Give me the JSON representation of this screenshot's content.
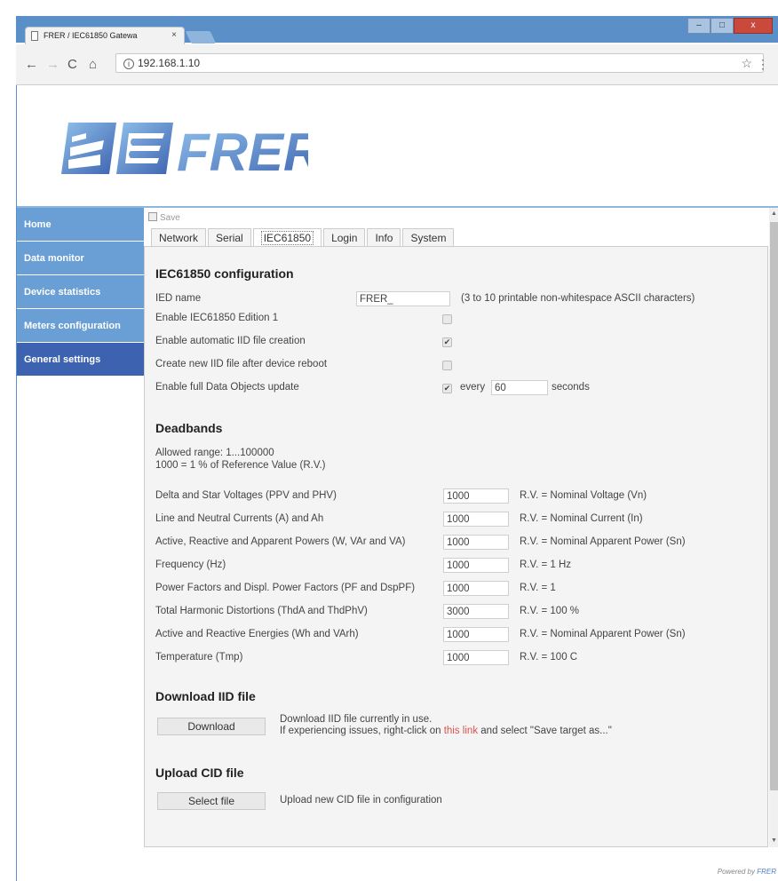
{
  "browser": {
    "tab_title": "FRER / IEC61850 Gatewa",
    "tab_close": "×",
    "url": "192.168.1.10",
    "back": "←",
    "forward": "→",
    "reload": "C",
    "home": "⌂",
    "info": "i",
    "star": "☆",
    "menu": "⋮",
    "minimize": "–",
    "maximize": "□",
    "close": "x"
  },
  "brand": {
    "name": "FRER",
    "primary_color": "#3d63b0",
    "accent_color": "#6a9fd6"
  },
  "sidebar": {
    "items": [
      {
        "label": "Home"
      },
      {
        "label": "Data monitor"
      },
      {
        "label": "Device statistics"
      },
      {
        "label": "Meters configuration"
      },
      {
        "label": "General settings",
        "active": true
      }
    ]
  },
  "toolbar": {
    "save_label": "Save"
  },
  "tabs": [
    {
      "label": "Network"
    },
    {
      "label": "Serial"
    },
    {
      "label": "IEC61850",
      "active": true
    },
    {
      "label": "Login"
    },
    {
      "label": "Info"
    },
    {
      "label": "System"
    }
  ],
  "iec": {
    "title": "IEC61850 configuration",
    "ied_name_label": "IED name",
    "ied_name_value": "FRER_",
    "ied_name_hint": "(3 to 10 printable non-whitespace ASCII characters)",
    "edition1_label": "Enable IEC61850 Edition 1",
    "edition1_checked": false,
    "auto_iid_label": "Enable automatic IID file creation",
    "auto_iid_checked": true,
    "reboot_iid_label": "Create new IID file after device reboot",
    "reboot_iid_checked": false,
    "full_update_label": "Enable full Data Objects update",
    "full_update_checked": true,
    "every_label": "every",
    "every_value": "60",
    "seconds_label": "seconds"
  },
  "deadbands": {
    "title": "Deadbands",
    "allowed_range": "Allowed range: 1...100000",
    "rv_note": "1000 = 1 % of Reference Value (R.V.)",
    "rows": [
      {
        "label": "Delta and Star Voltages (PPV and PHV)",
        "value": "1000",
        "rv": "R.V. = Nominal Voltage (Vn)"
      },
      {
        "label": "Line and Neutral Currents (A) and Ah",
        "value": "1000",
        "rv": "R.V. = Nominal Current (In)"
      },
      {
        "label": "Active, Reactive and Apparent Powers (W, VAr and VA)",
        "value": "1000",
        "rv": "R.V. = Nominal Apparent Power (Sn)"
      },
      {
        "label": "Frequency (Hz)",
        "value": "1000",
        "rv": "R.V. = 1 Hz"
      },
      {
        "label": "Power Factors and Displ. Power Factors (PF and DspPF)",
        "value": "1000",
        "rv": "R.V. = 1"
      },
      {
        "label": "Total Harmonic Distortions (ThdA and ThdPhV)",
        "value": "3000",
        "rv": "R.V. = 100 %"
      },
      {
        "label": "Active and Reactive Energies (Wh and VArh)",
        "value": "1000",
        "rv": "R.V. = Nominal Apparent Power (Sn)"
      },
      {
        "label": "Temperature (Tmp)",
        "value": "1000",
        "rv": "R.V. = 100 C"
      }
    ]
  },
  "download": {
    "title": "Download IID file",
    "button": "Download",
    "line1": "Download IID file currently in use.",
    "line2_pre": "If experiencing issues, right-click on ",
    "line2_link": "this link",
    "line2_post": " and select \"Save target as...\""
  },
  "upload": {
    "title": "Upload CID file",
    "button": "Select file",
    "desc": "Upload new CID file in configuration"
  },
  "footer": {
    "powered_by": "Powered by",
    "brand": "FRER"
  }
}
